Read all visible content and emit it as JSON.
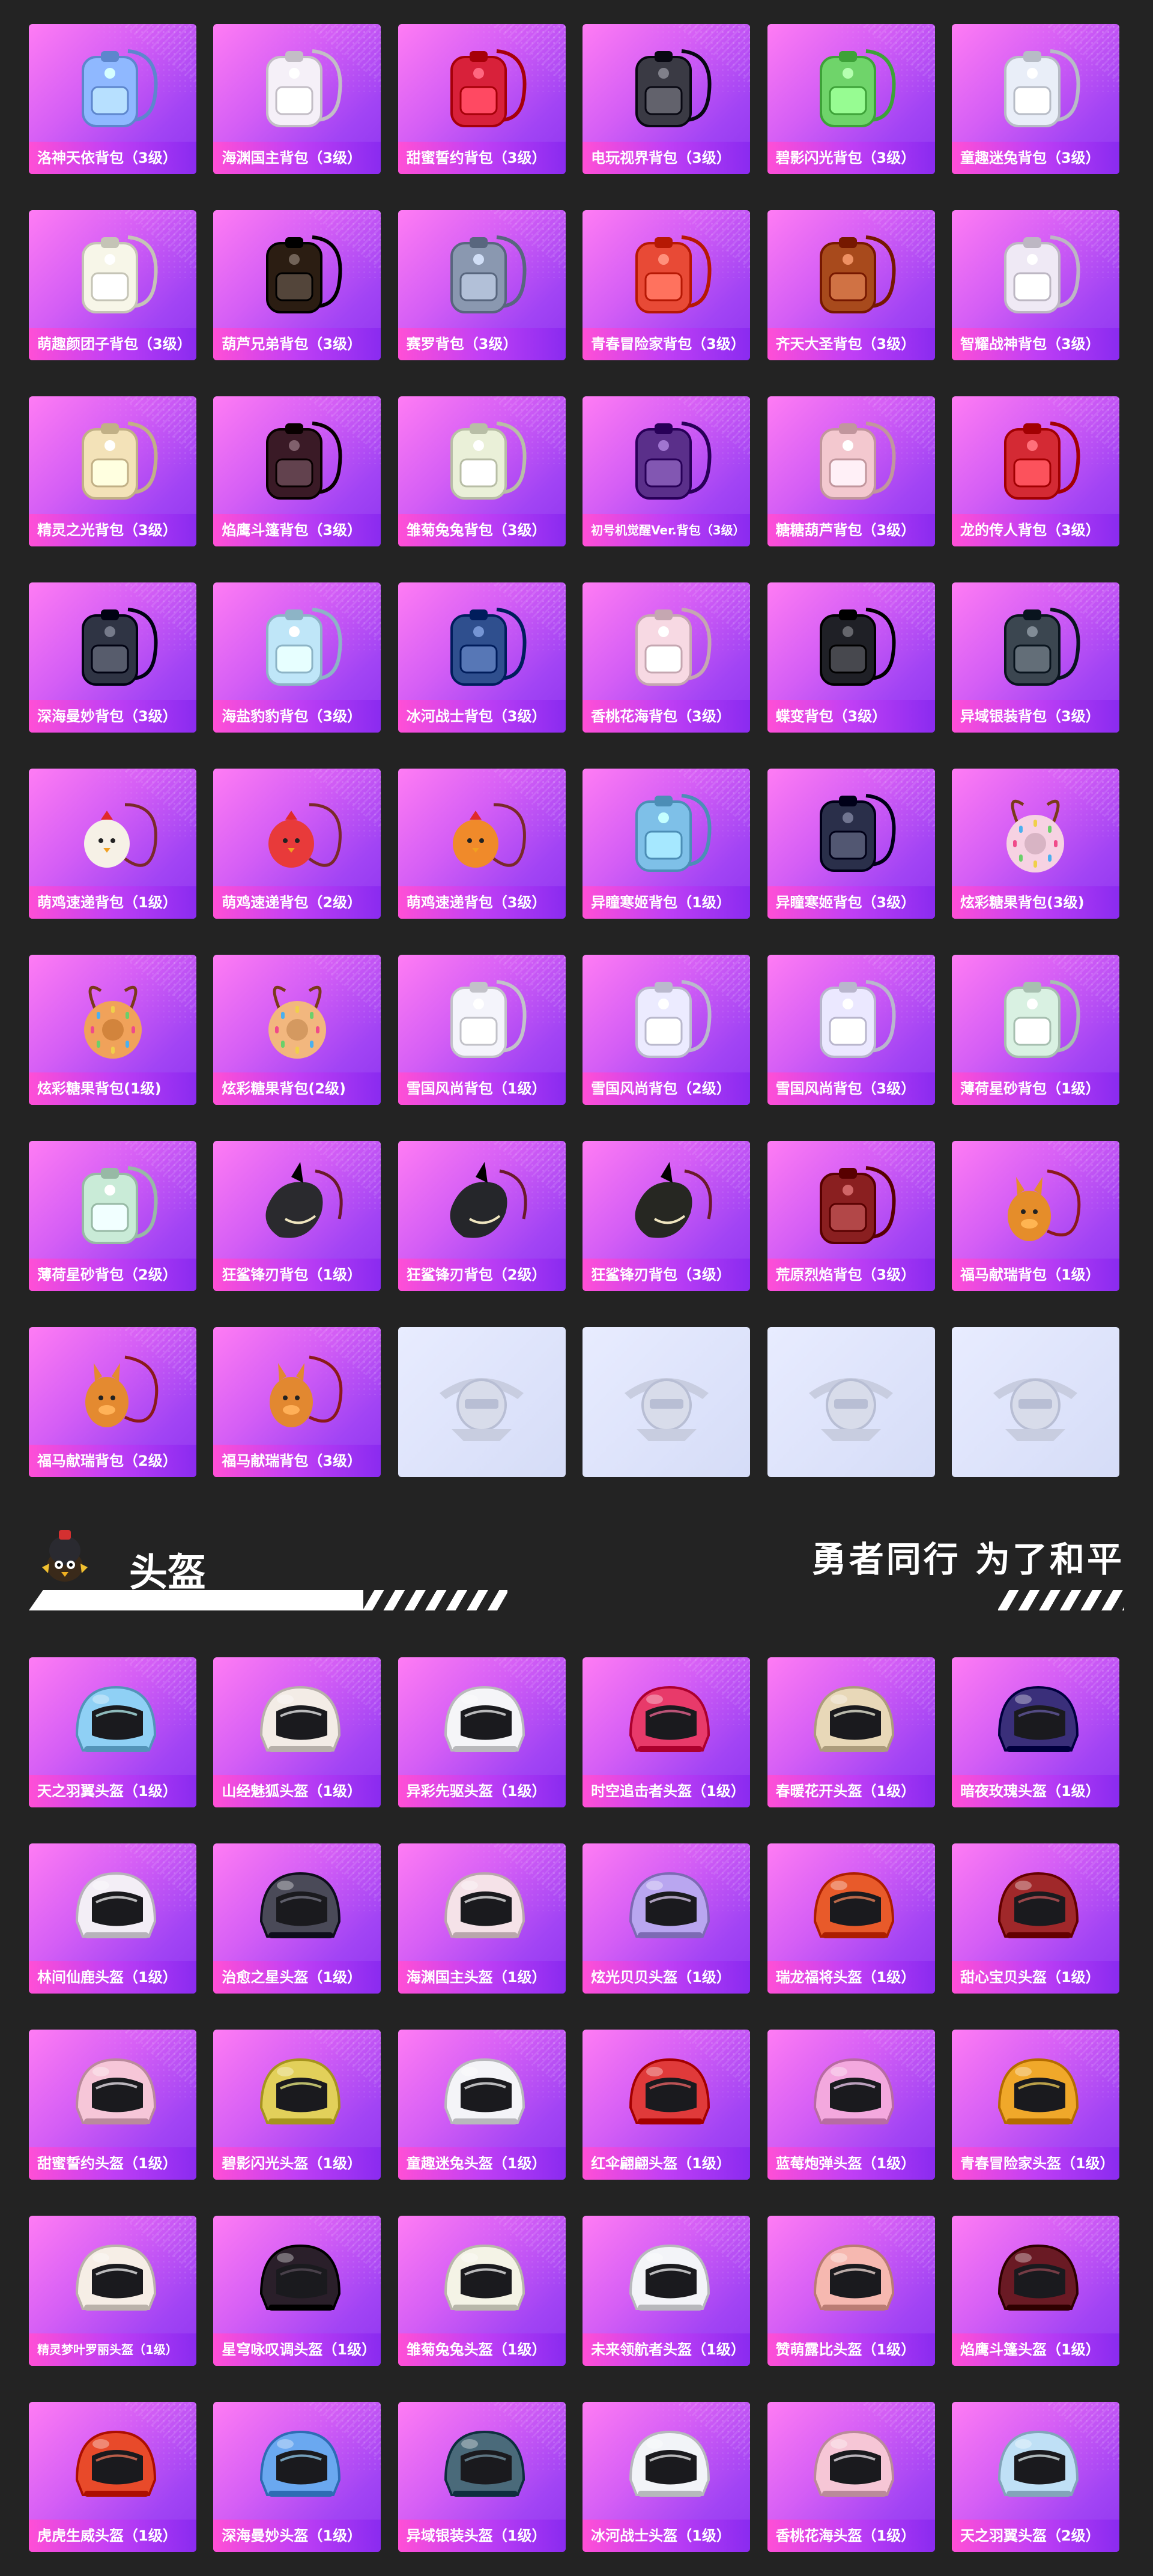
{
  "backpacks": [
    {
      "label": "洛神天依背包（3级）",
      "color": "#8fb8ff",
      "shape": "bag"
    },
    {
      "label": "海渊国主背包（3级）",
      "color": "#f5f0f8",
      "shape": "bag"
    },
    {
      "label": "甜蜜誓约背包（3级）",
      "color": "#d8213a",
      "shape": "bag"
    },
    {
      "label": "电玩视界背包（3级）",
      "color": "#3a3a44",
      "shape": "bag"
    },
    {
      "label": "碧影闪光背包（3级）",
      "color": "#6fd46a",
      "shape": "bag"
    },
    {
      "label": "童趣迷兔背包（3级）",
      "color": "#e9eef8",
      "shape": "bag"
    },
    {
      "label": "萌趣颜团子背包（3级）",
      "color": "#f7f6e8",
      "shape": "bag"
    },
    {
      "label": "葫芦兄弟背包（3级）",
      "color": "#2b1d12",
      "shape": "bag"
    },
    {
      "label": "赛罗背包（3级）",
      "color": "#8a98b0",
      "shape": "bag"
    },
    {
      "label": "青春冒险家背包（3级）",
      "color": "#e84a36",
      "shape": "bag"
    },
    {
      "label": "齐天大圣背包（3级）",
      "color": "#a84a1c",
      "shape": "bag"
    },
    {
      "label": "智耀战神背包（3级）",
      "color": "#efe9f5",
      "shape": "bag"
    },
    {
      "label": "精灵之光背包（3级）",
      "color": "#f3e2b8",
      "shape": "bag"
    },
    {
      "label": "焰鹰斗篷背包（3级）",
      "color": "#3a1a26",
      "shape": "bag"
    },
    {
      "label": "雏菊兔兔背包（3级）",
      "color": "#eaf0d8",
      "shape": "bag"
    },
    {
      "label": "初号机觉醒Ver.背包（3级）",
      "color": "#5a2f8a",
      "shape": "bag",
      "small": true
    },
    {
      "label": "糖糖葫芦背包（3级）",
      "color": "#f3c8cf",
      "shape": "bag"
    },
    {
      "label": "龙的传人背包（3级）",
      "color": "#d42a34",
      "shape": "bag"
    },
    {
      "label": "深海曼妙背包（3级）",
      "color": "#2f3444",
      "shape": "bag"
    },
    {
      "label": "海盐豹豹背包（3级）",
      "color": "#bfe6f8",
      "shape": "bag"
    },
    {
      "label": "冰河战士背包（3级）",
      "color": "#2f4f8e",
      "shape": "bag"
    },
    {
      "label": "香桃花海背包（3级）",
      "color": "#f7d9e3",
      "shape": "bag"
    },
    {
      "label": "蝶变背包（3级）",
      "color": "#1f2026",
      "shape": "bag"
    },
    {
      "label": "异域银装背包（3级）",
      "color": "#3b4650",
      "shape": "bag"
    },
    {
      "label": "萌鸡速递背包（1级）",
      "color": "#f6f1e6",
      "shape": "chick"
    },
    {
      "label": "萌鸡速递背包（2级）",
      "color": "#e83a3a",
      "shape": "chick"
    },
    {
      "label": "萌鸡速递背包（3级）",
      "color": "#f08a2a",
      "shape": "chick"
    },
    {
      "label": "异瞳寒姬背包（1级）",
      "color": "#7ec0e8",
      "shape": "bag"
    },
    {
      "label": "异瞳寒姬背包（3级）",
      "color": "#2a2f4a",
      "shape": "bag"
    },
    {
      "label": "炫彩糖果背包(3级)",
      "color": "#f6d2e2",
      "shape": "donut"
    },
    {
      "label": "炫彩糖果背包(1级)",
      "color": "#f0a25a",
      "shape": "donut"
    },
    {
      "label": "炫彩糖果背包(2级)",
      "color": "#f2b77e",
      "shape": "donut"
    },
    {
      "label": "雪国风尚背包（1级）",
      "color": "#f4f4fb",
      "shape": "bag"
    },
    {
      "label": "雪国风尚背包（2级）",
      "color": "#ecebff",
      "shape": "bag"
    },
    {
      "label": "雪国风尚背包（3级）",
      "color": "#ebe8ff",
      "shape": "bag"
    },
    {
      "label": "薄荷星砂背包（1级）",
      "color": "#d9f1e2",
      "shape": "bag"
    },
    {
      "label": "薄荷星砂背包（2级）",
      "color": "#c9ebd7",
      "shape": "bag"
    },
    {
      "label": "狂鲨锋刃背包（1级）",
      "color": "#2a2a2e",
      "shape": "shark"
    },
    {
      "label": "狂鲨锋刃背包（2级）",
      "color": "#25262a",
      "shape": "shark"
    },
    {
      "label": "狂鲨锋刃背包（3级）",
      "color": "#262722",
      "shape": "shark"
    },
    {
      "label": "荒原烈焰背包（3级）",
      "color": "#8a1f20",
      "shape": "bag"
    },
    {
      "label": "福马献瑞背包（1级）",
      "color": "#e58d2a",
      "shape": "horse"
    },
    {
      "label": "福马献瑞背包（2级）",
      "color": "#e48a30",
      "shape": "horse"
    },
    {
      "label": "福马献瑞背包（3级）",
      "color": "#e28830",
      "shape": "horse"
    },
    {
      "label": "",
      "color": "#cfd6ea",
      "shape": "emblem",
      "empty": true
    },
    {
      "label": "",
      "color": "#cfd6ea",
      "shape": "emblem",
      "empty": true
    },
    {
      "label": "",
      "color": "#cfd6ea",
      "shape": "emblem",
      "empty": true
    },
    {
      "label": "",
      "color": "#cfd6ea",
      "shape": "emblem",
      "empty": true
    }
  ],
  "section": {
    "title": "头盔",
    "slogan": "勇者同行 为了和平"
  },
  "helmets": [
    {
      "label": "天之羽翼头盔（1级）",
      "color": "#8fd0f5"
    },
    {
      "label": "山经魅狐头盔（1级）",
      "color": "#f3ece6"
    },
    {
      "label": "异彩先驱头盔（1级）",
      "color": "#f5f5f8"
    },
    {
      "label": "时空追击者头盔（1级）",
      "color": "#e83a6a"
    },
    {
      "label": "春暖花开头盔（1级）",
      "color": "#e8d8b8"
    },
    {
      "label": "暗夜玫瑰头盔（1级）",
      "color": "#3a2f7a"
    },
    {
      "label": "林间仙鹿头盔（1级）",
      "color": "#f3eef6"
    },
    {
      "label": "治愈之星头盔（1级）",
      "color": "#4a4a58"
    },
    {
      "label": "海渊国主头盔（1级）",
      "color": "#f5e2e8"
    },
    {
      "label": "炫光贝贝头盔（1级）",
      "color": "#b9a6f0"
    },
    {
      "label": "瑞龙福将头盔（1级）",
      "color": "#e85a2a"
    },
    {
      "label": "甜心宝贝头盔（1级）",
      "color": "#a0282a"
    },
    {
      "label": "甜蜜誓约头盔（1级）",
      "color": "#f6c6d8"
    },
    {
      "label": "碧影闪光头盔（1级）",
      "color": "#e2d05a"
    },
    {
      "label": "童趣迷兔头盔（1级）",
      "color": "#f4f4f8"
    },
    {
      "label": "红伞翩翩头盔（1级）",
      "color": "#e03a3a"
    },
    {
      "label": "蓝莓炮弹头盔（1级）",
      "color": "#f3a8de"
    },
    {
      "label": "青春冒险家头盔（1级）",
      "color": "#f0a82a"
    },
    {
      "label": "精灵梦叶罗丽头盔（1级）",
      "color": "#f6eee6",
      "small": true
    },
    {
      "label": "星穹咏叹调头盔（1级）",
      "color": "#2a1f2a"
    },
    {
      "label": "雏菊兔兔头盔（1级）",
      "color": "#f4f3e6"
    },
    {
      "label": "未来领航者头盔（1级）",
      "color": "#f3f4f8"
    },
    {
      "label": "赞萌露比头盔（1级）",
      "color": "#f6b8b0"
    },
    {
      "label": "焰鹰斗篷头盔（1级）",
      "color": "#6a1a24"
    },
    {
      "label": "虎虎生威头盔（1级）",
      "color": "#e84a2a"
    },
    {
      "label": "深海曼妙头盔（1级）",
      "color": "#6aa8f0"
    },
    {
      "label": "异域银装头盔（1级）",
      "color": "#4a6a7a"
    },
    {
      "label": "冰河战士头盔（1级）",
      "color": "#f2f4f8"
    },
    {
      "label": "香桃花海头盔（1级）",
      "color": "#f6c6d6"
    },
    {
      "label": "天之羽翼头盔（2级）",
      "color": "#bfe0f6"
    }
  ]
}
